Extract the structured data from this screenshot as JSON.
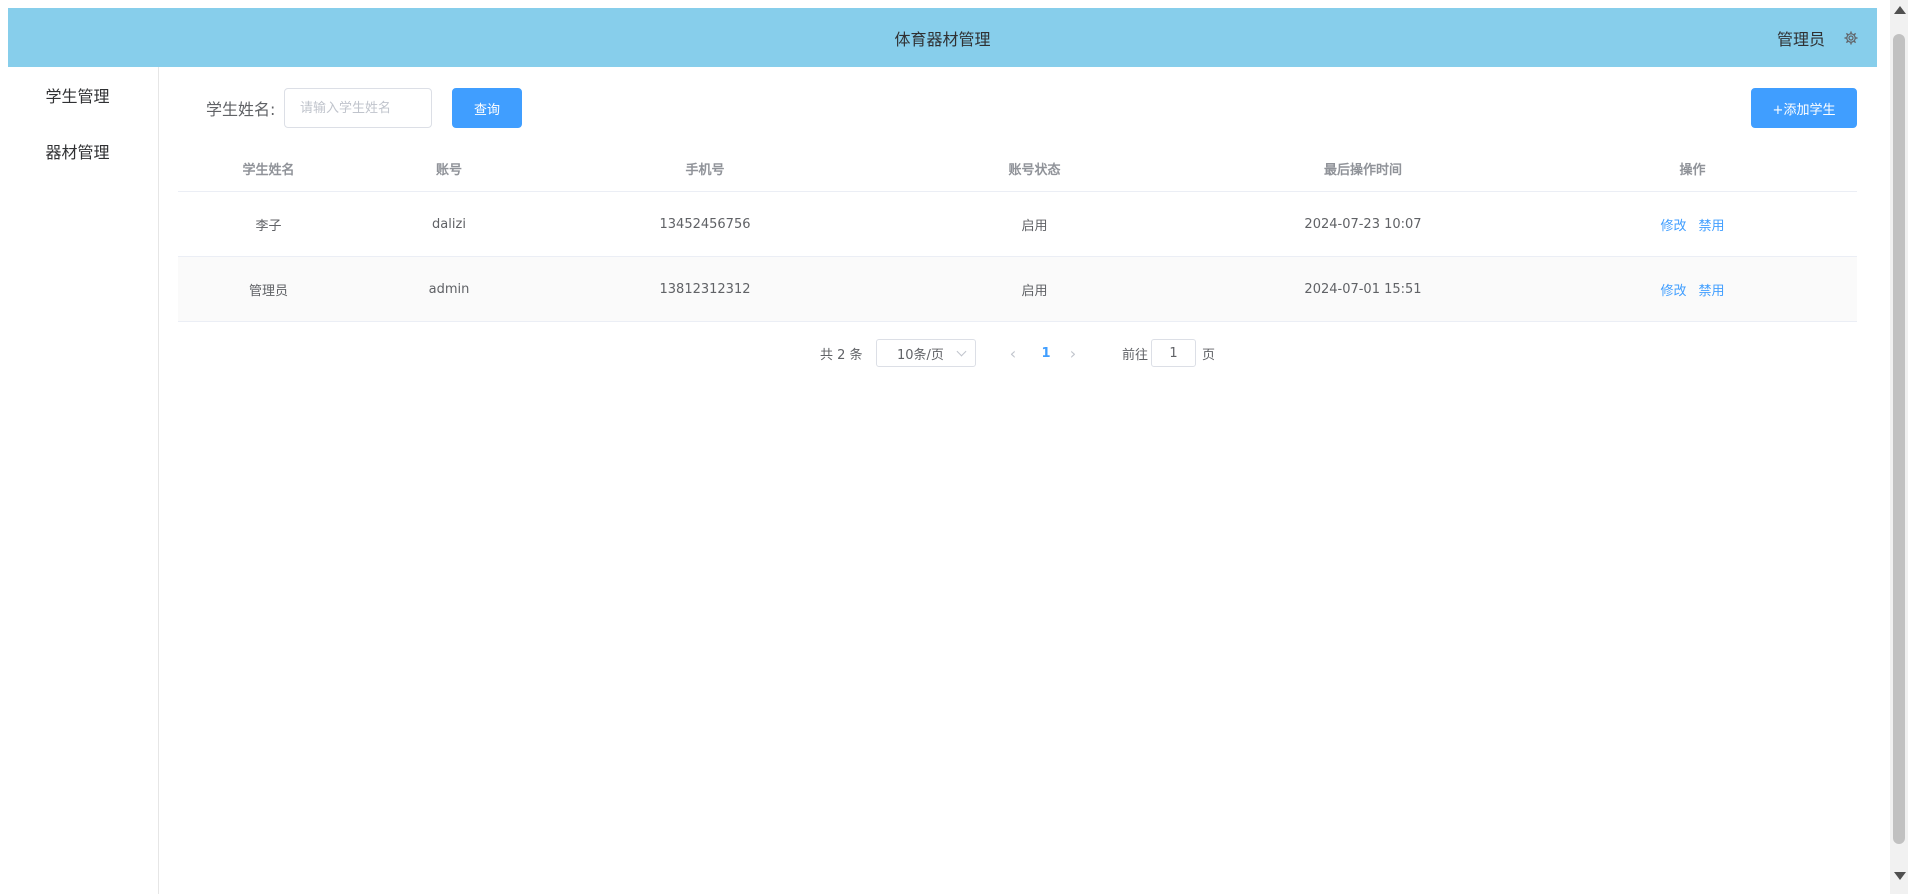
{
  "header": {
    "title": "体育器材管理",
    "user": "管理员",
    "bg_color": "#87ceeb",
    "settings_icon": "gear-icon"
  },
  "sidebar": {
    "items": [
      {
        "label": "学生管理"
      },
      {
        "label": "器材管理"
      }
    ]
  },
  "search": {
    "label": "学生姓名:",
    "placeholder": "请输入学生姓名",
    "value": "",
    "query_label": "查询"
  },
  "toolbar": {
    "add_label": "+添加学生",
    "accent_color": "#409eff"
  },
  "table": {
    "columns": [
      "学生姓名",
      "账号",
      "手机号",
      "账号状态",
      "最后操作时间",
      "操作"
    ],
    "rows": [
      {
        "name": "李子",
        "account": "dalizi",
        "phone": "13452456756",
        "status": "启用",
        "last_time": "2024-07-23 10:07",
        "edit": "修改",
        "disable": "禁用"
      },
      {
        "name": "管理员",
        "account": "admin",
        "phone": "13812312312",
        "status": "启用",
        "last_time": "2024-07-01 15:51",
        "edit": "修改",
        "disable": "禁用"
      }
    ]
  },
  "pagination": {
    "total": "共 2 条",
    "page_size": "10条/页",
    "current_page": "1",
    "goto_label": "前往",
    "goto_value": "1",
    "page_unit": "页"
  }
}
